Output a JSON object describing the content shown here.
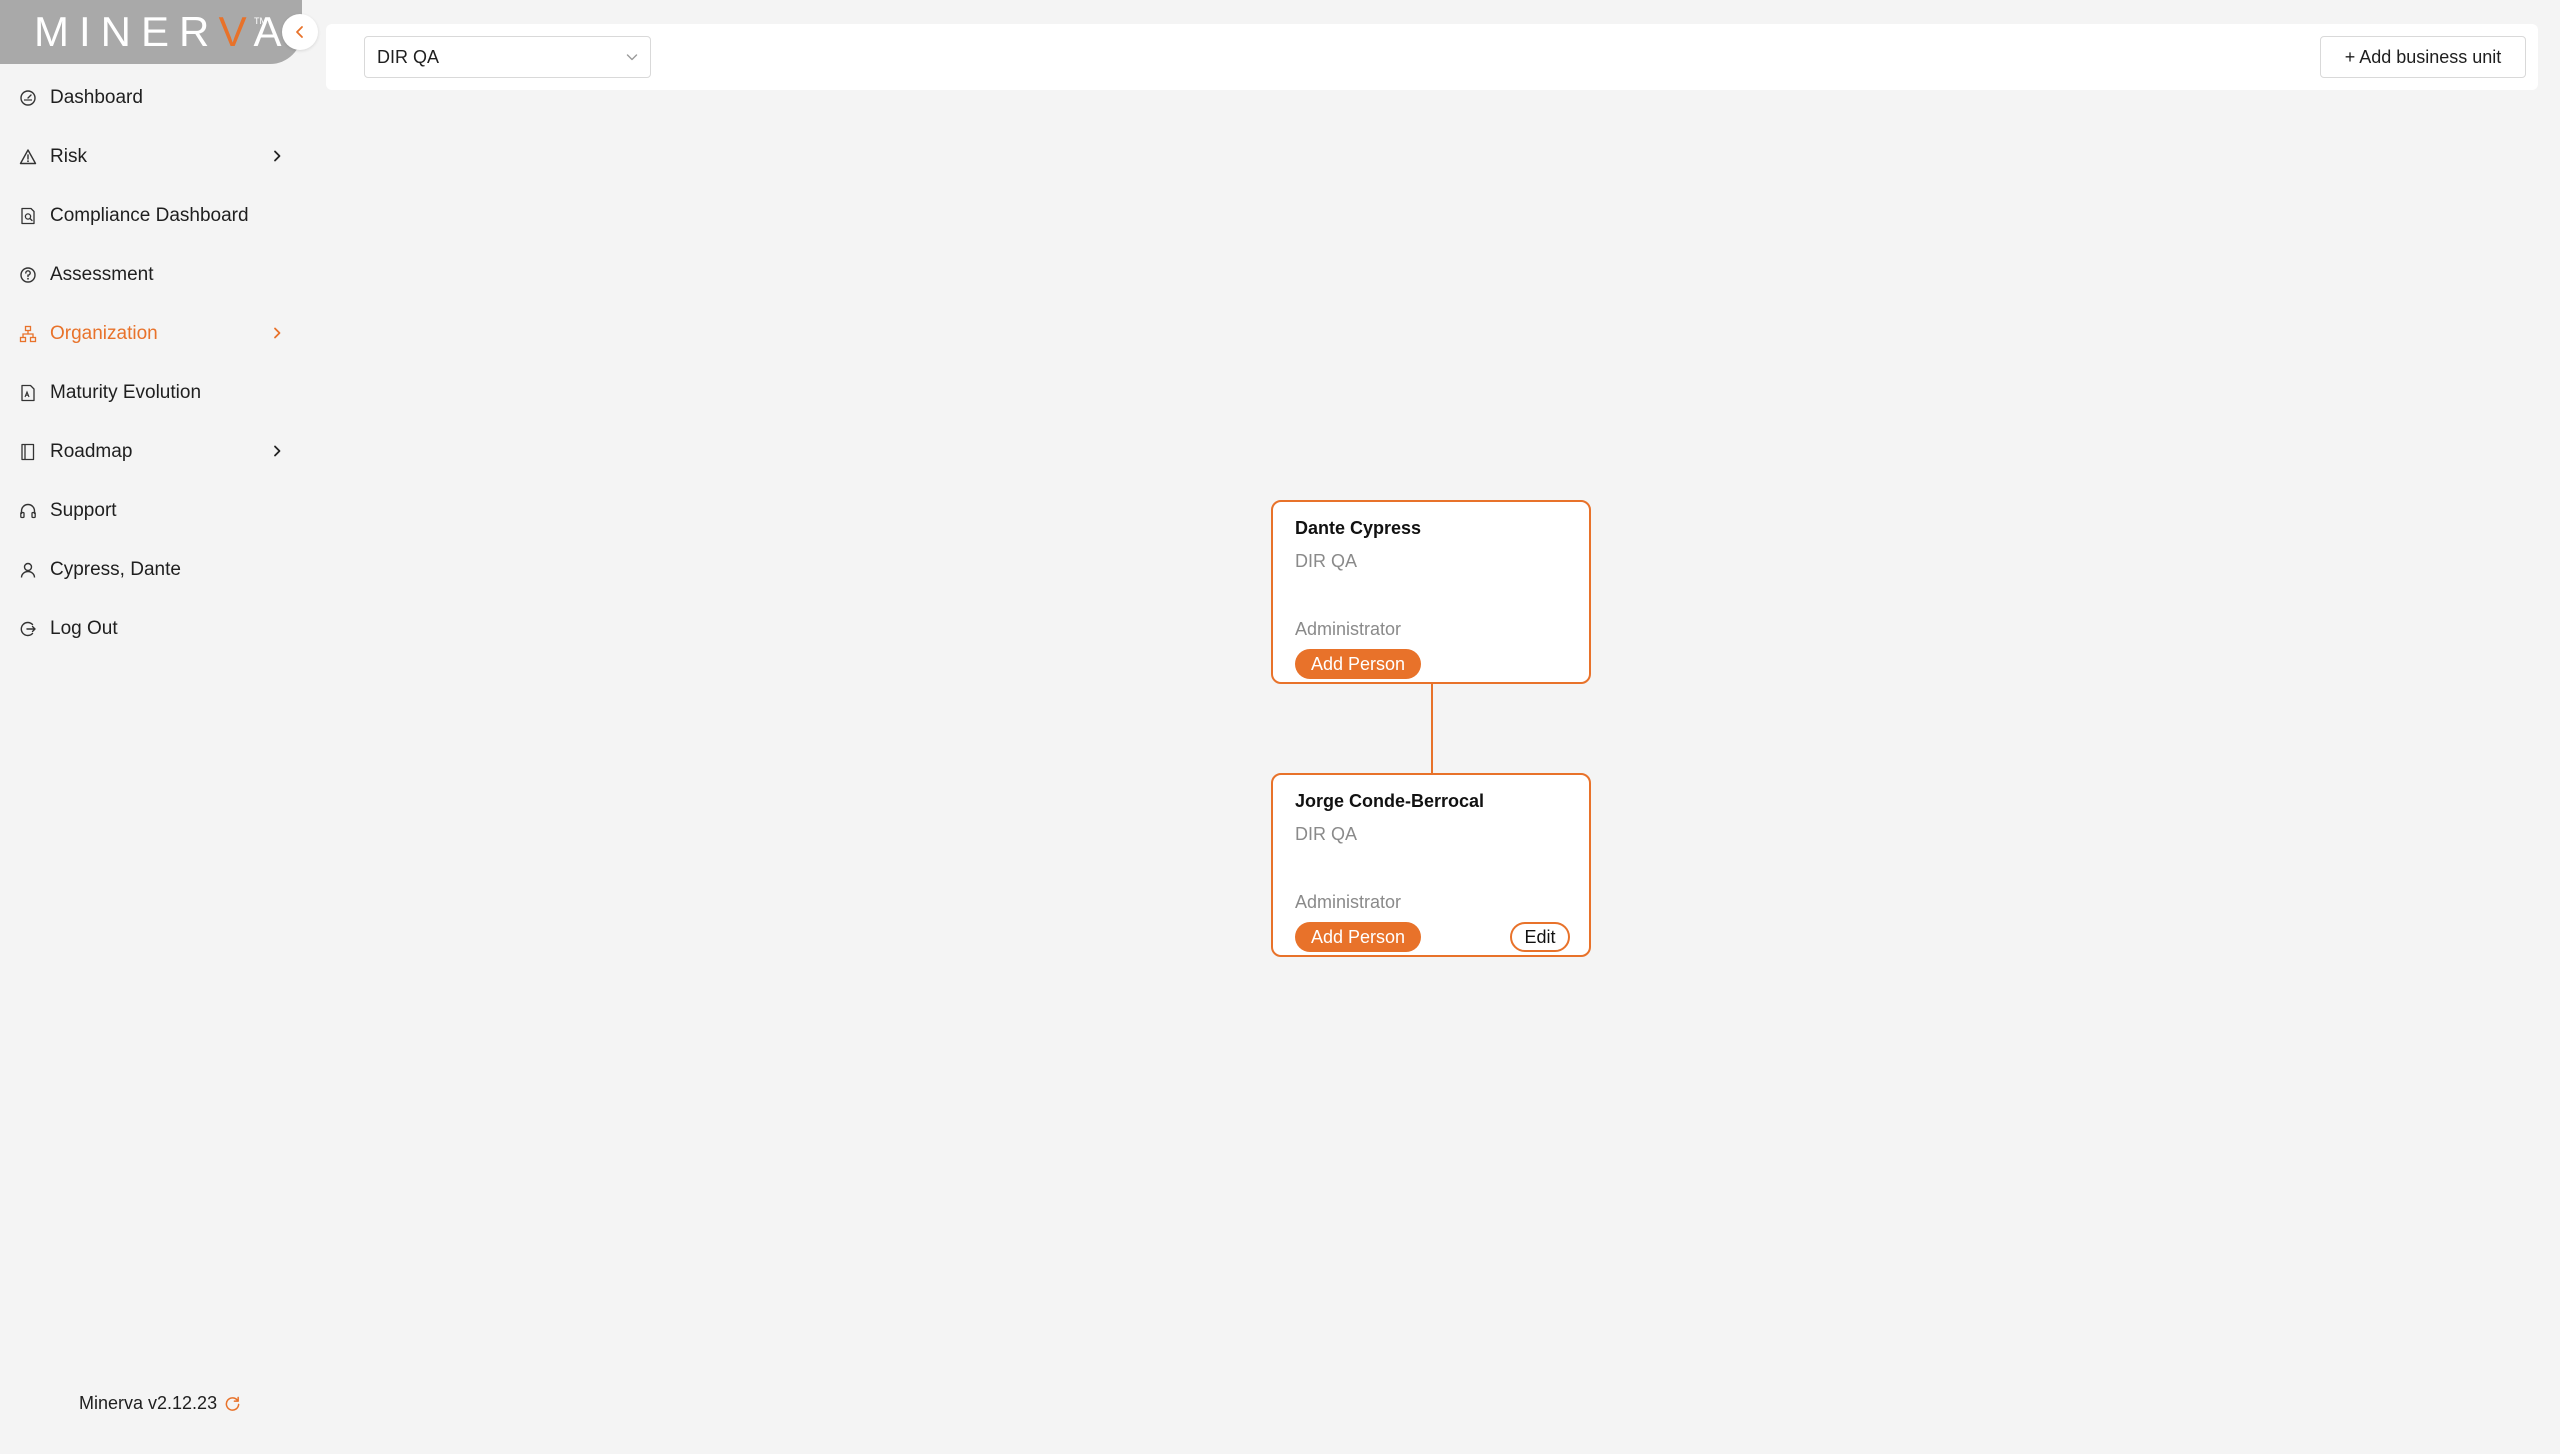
{
  "app": {
    "logo_prefix": "MINER",
    "logo_accent": "V",
    "logo_suffix": "A",
    "logo_tm": "TM",
    "version": "Minerva v2.12.23"
  },
  "colors": {
    "accent": "#e8722a",
    "sidebar_logo_bg": "#a9a9a9",
    "page_bg": "#f4f4f4"
  },
  "sidebar": {
    "items": [
      {
        "label": "Dashboard",
        "icon": "gauge-icon"
      },
      {
        "label": "Risk",
        "icon": "warning-triangle-icon",
        "has_children": true
      },
      {
        "label": "Compliance Dashboard",
        "icon": "document-search-icon"
      },
      {
        "label": "Assessment",
        "icon": "question-circle-icon"
      },
      {
        "label": "Organization",
        "icon": "org-chart-icon",
        "has_children": true,
        "active": true
      },
      {
        "label": "Maturity Evolution",
        "icon": "pdf-document-icon"
      },
      {
        "label": "Roadmap",
        "icon": "book-icon",
        "has_children": true
      },
      {
        "label": "Support",
        "icon": "headset-icon"
      },
      {
        "label": "Cypress, Dante",
        "icon": "user-icon"
      },
      {
        "label": "Log Out",
        "icon": "logout-icon"
      }
    ]
  },
  "header": {
    "business_unit_selected": "DIR QA",
    "add_business_unit_label": "+ Add business unit"
  },
  "org_chart": {
    "people": [
      {
        "name": "Dante Cypress",
        "unit": "DIR QA",
        "role": "Administrator",
        "add_person_label": "Add Person"
      },
      {
        "name": "Jorge Conde-Berrocal",
        "unit": "DIR QA",
        "role": "Administrator",
        "add_person_label": "Add Person",
        "edit_label": "Edit"
      }
    ]
  }
}
